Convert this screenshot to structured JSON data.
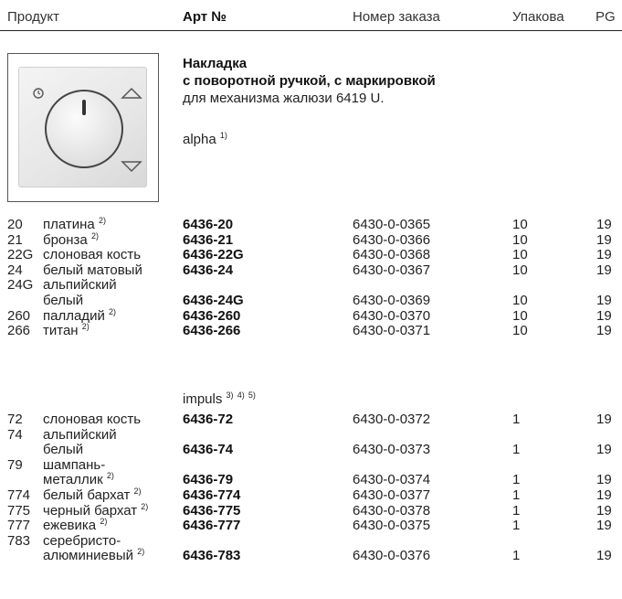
{
  "header": {
    "product": "Продукт",
    "art": "Арт №",
    "order": "Номер заказа",
    "pack": "Упакова",
    "pg": "PG"
  },
  "description": {
    "title": "Накладка",
    "subtitle": "с поворотной ручкой, с маркировкой",
    "note": "для механизма жалюзи 6419 U.",
    "series": "alpha",
    "series_sup": "1)"
  },
  "series2": {
    "label": "impuls",
    "sups": [
      "3)",
      "4)",
      "5)"
    ]
  },
  "rows_alpha": [
    {
      "num": "20",
      "name": "платина",
      "sup": "2)",
      "art": "6436-20",
      "order": "6430-0-0365",
      "pack": "10",
      "pg": "19"
    },
    {
      "num": "21",
      "name": "бронза",
      "sup": "2)",
      "art": "6436-21",
      "order": "6430-0-0366",
      "pack": "10",
      "pg": "19"
    },
    {
      "num": "22G",
      "name": "слоновая кость",
      "sup": "",
      "art": "6436-22G",
      "order": "6430-0-0368",
      "pack": "10",
      "pg": "19"
    },
    {
      "num": "24",
      "name": "белый матовый",
      "sup": "",
      "art": "6436-24",
      "order": "6430-0-0367",
      "pack": "10",
      "pg": "19"
    },
    {
      "num": "24G",
      "name": "альпийский",
      "name2": "белый",
      "sup": "",
      "art": "6436-24G",
      "order": "6430-0-0369",
      "pack": "10",
      "pg": "19"
    },
    {
      "num": "260",
      "name": "палладий",
      "sup": "2)",
      "art": "6436-260",
      "order": "6430-0-0370",
      "pack": "10",
      "pg": "19"
    },
    {
      "num": "266",
      "name": "титан",
      "sup": "2)",
      "art": "6436-266",
      "order": "6430-0-0371",
      "pack": "10",
      "pg": "19"
    }
  ],
  "rows_impuls": [
    {
      "num": "72",
      "name": "слоновая кость",
      "sup": "",
      "art": "6436-72",
      "order": "6430-0-0372",
      "pack": "1",
      "pg": "19"
    },
    {
      "num": "74",
      "name": "альпийский",
      "name2": "белый",
      "sup": "",
      "art": "6436-74",
      "order": "6430-0-0373",
      "pack": "1",
      "pg": "19"
    },
    {
      "num": "79",
      "name": "шампань-",
      "name2": "металлик",
      "sup": "2)",
      "art": "6436-79",
      "order": "6430-0-0374",
      "pack": "1",
      "pg": "19"
    },
    {
      "num": "774",
      "name": "белый бархат",
      "sup": "2)",
      "art": "6436-774",
      "order": "6430-0-0377",
      "pack": "1",
      "pg": "19"
    },
    {
      "num": "775",
      "name": "черный бархат",
      "sup": "2)",
      "art": "6436-775",
      "order": "6430-0-0378",
      "pack": "1",
      "pg": "19"
    },
    {
      "num": "777",
      "name": "ежевика",
      "sup": "2)",
      "art": "6436-777",
      "order": "6430-0-0375",
      "pack": "1",
      "pg": "19"
    },
    {
      "num": "783",
      "name": "серебристо-",
      "name2": "алюминиевый",
      "sup": "2)",
      "art": "6436-783",
      "order": "6430-0-0376",
      "pack": "1",
      "pg": "19"
    }
  ]
}
